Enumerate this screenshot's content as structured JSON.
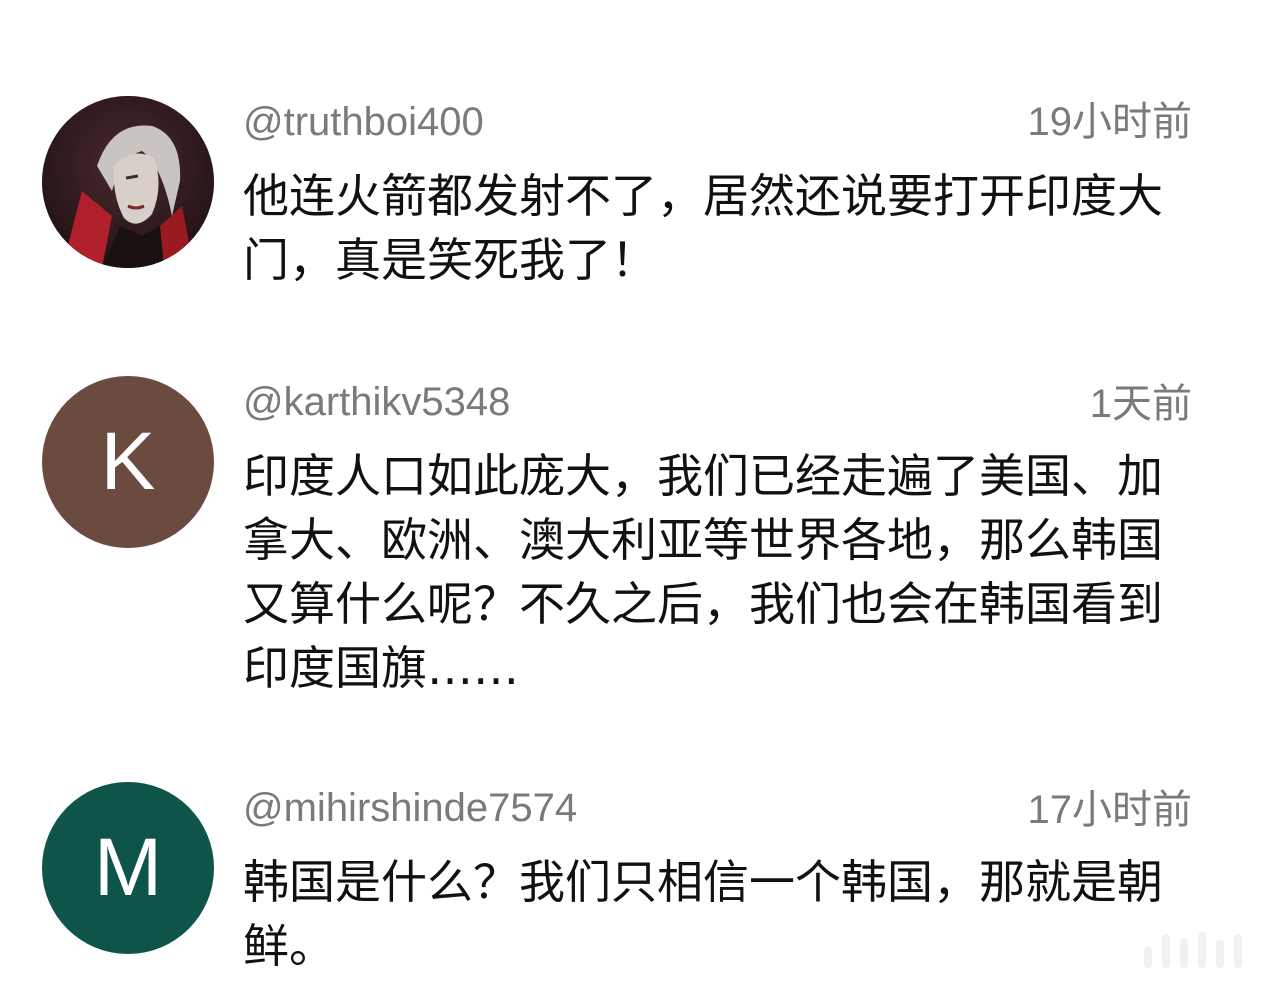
{
  "comments": [
    {
      "username": "@truthboi400",
      "time": "19小时前",
      "text": "他连火箭都发射不了，居然还说要打开印度大门，真是笑死我了！",
      "avatar": {
        "type": "image",
        "icon": "vampire-character-icon"
      }
    },
    {
      "username": "@karthikv5348",
      "time": "1天前",
      "text": "印度人口如此庞大，我们已经走遍了美国、加拿大、欧洲、澳大利亚等世界各地，那么韩国又算什么呢？不久之后，我们也会在韩国看到印度国旗……",
      "avatar": {
        "type": "letter",
        "letter": "K",
        "color": "#6b4a40"
      }
    },
    {
      "username": "@mihirshinde7574",
      "time": "17小时前",
      "text": "韩国是什么？我们只相信一个韩国，那就是朝鲜。",
      "avatar": {
        "type": "letter",
        "letter": "M",
        "color": "#0f5448"
      }
    }
  ],
  "colors": {
    "username": "#7a7a7a",
    "text": "#111111",
    "background": "#ffffff"
  }
}
